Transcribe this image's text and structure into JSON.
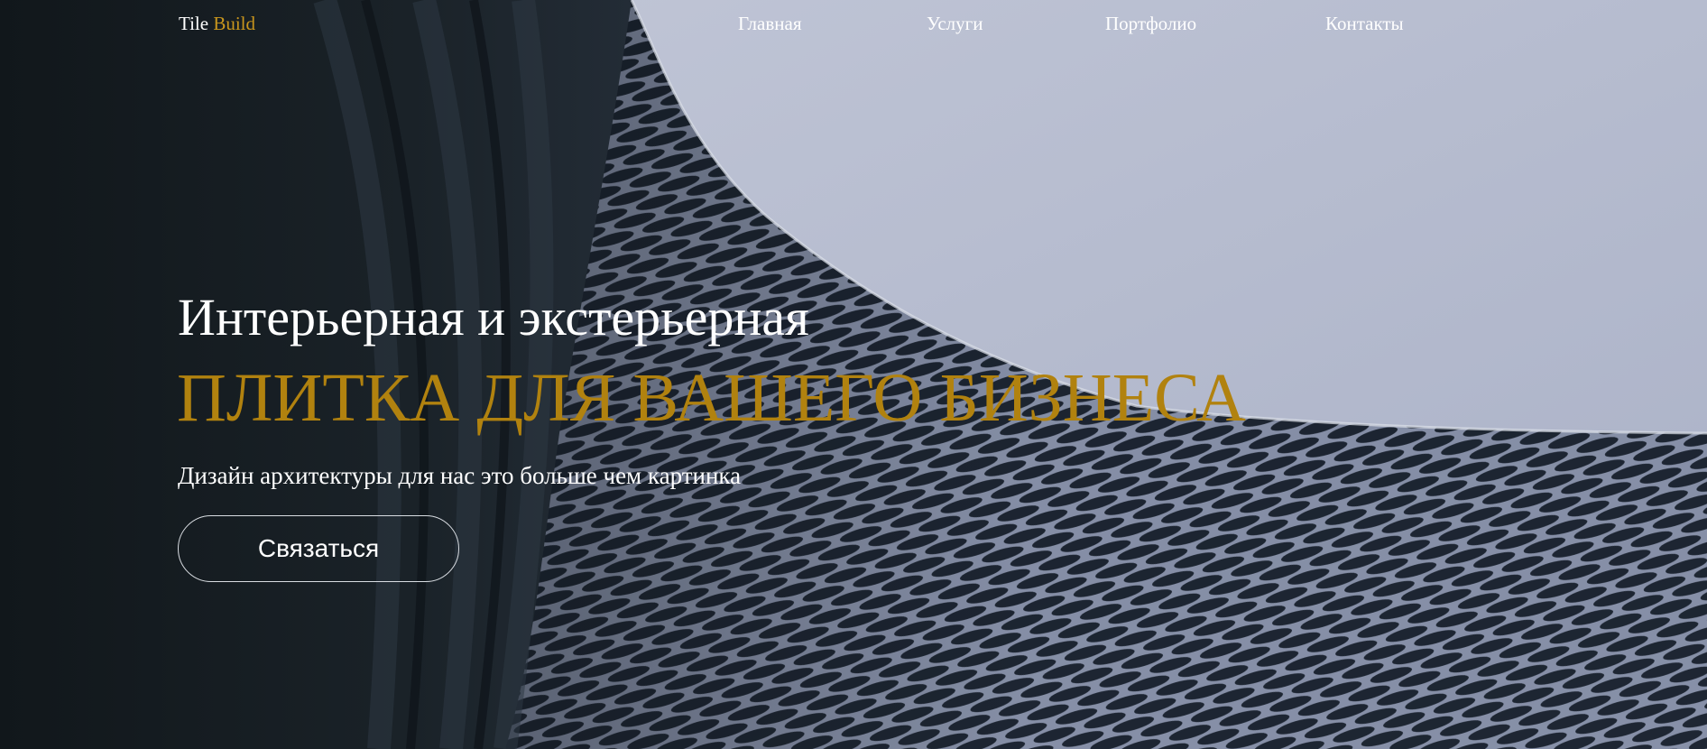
{
  "colors": {
    "accent": "#b1820f",
    "logo_accent": "#c9961d",
    "text": "#ffffff",
    "sky": "#b9bfd1",
    "background_dark": "#151b20"
  },
  "header": {
    "logo": {
      "primary": "Tile",
      "accent": "Build"
    },
    "nav": [
      {
        "label": "Главная"
      },
      {
        "label": "Услуги"
      },
      {
        "label": "Портфолио"
      },
      {
        "label": "Контакты"
      }
    ]
  },
  "hero": {
    "title": "Интерьерная и экстерьерная",
    "heading": "ПЛИТКА ДЛЯ ВАШЕГО БИЗНЕСА",
    "subtitle": "Дизайн архитектуры для нас это больше чем картинка",
    "button_label": "Связаться"
  }
}
